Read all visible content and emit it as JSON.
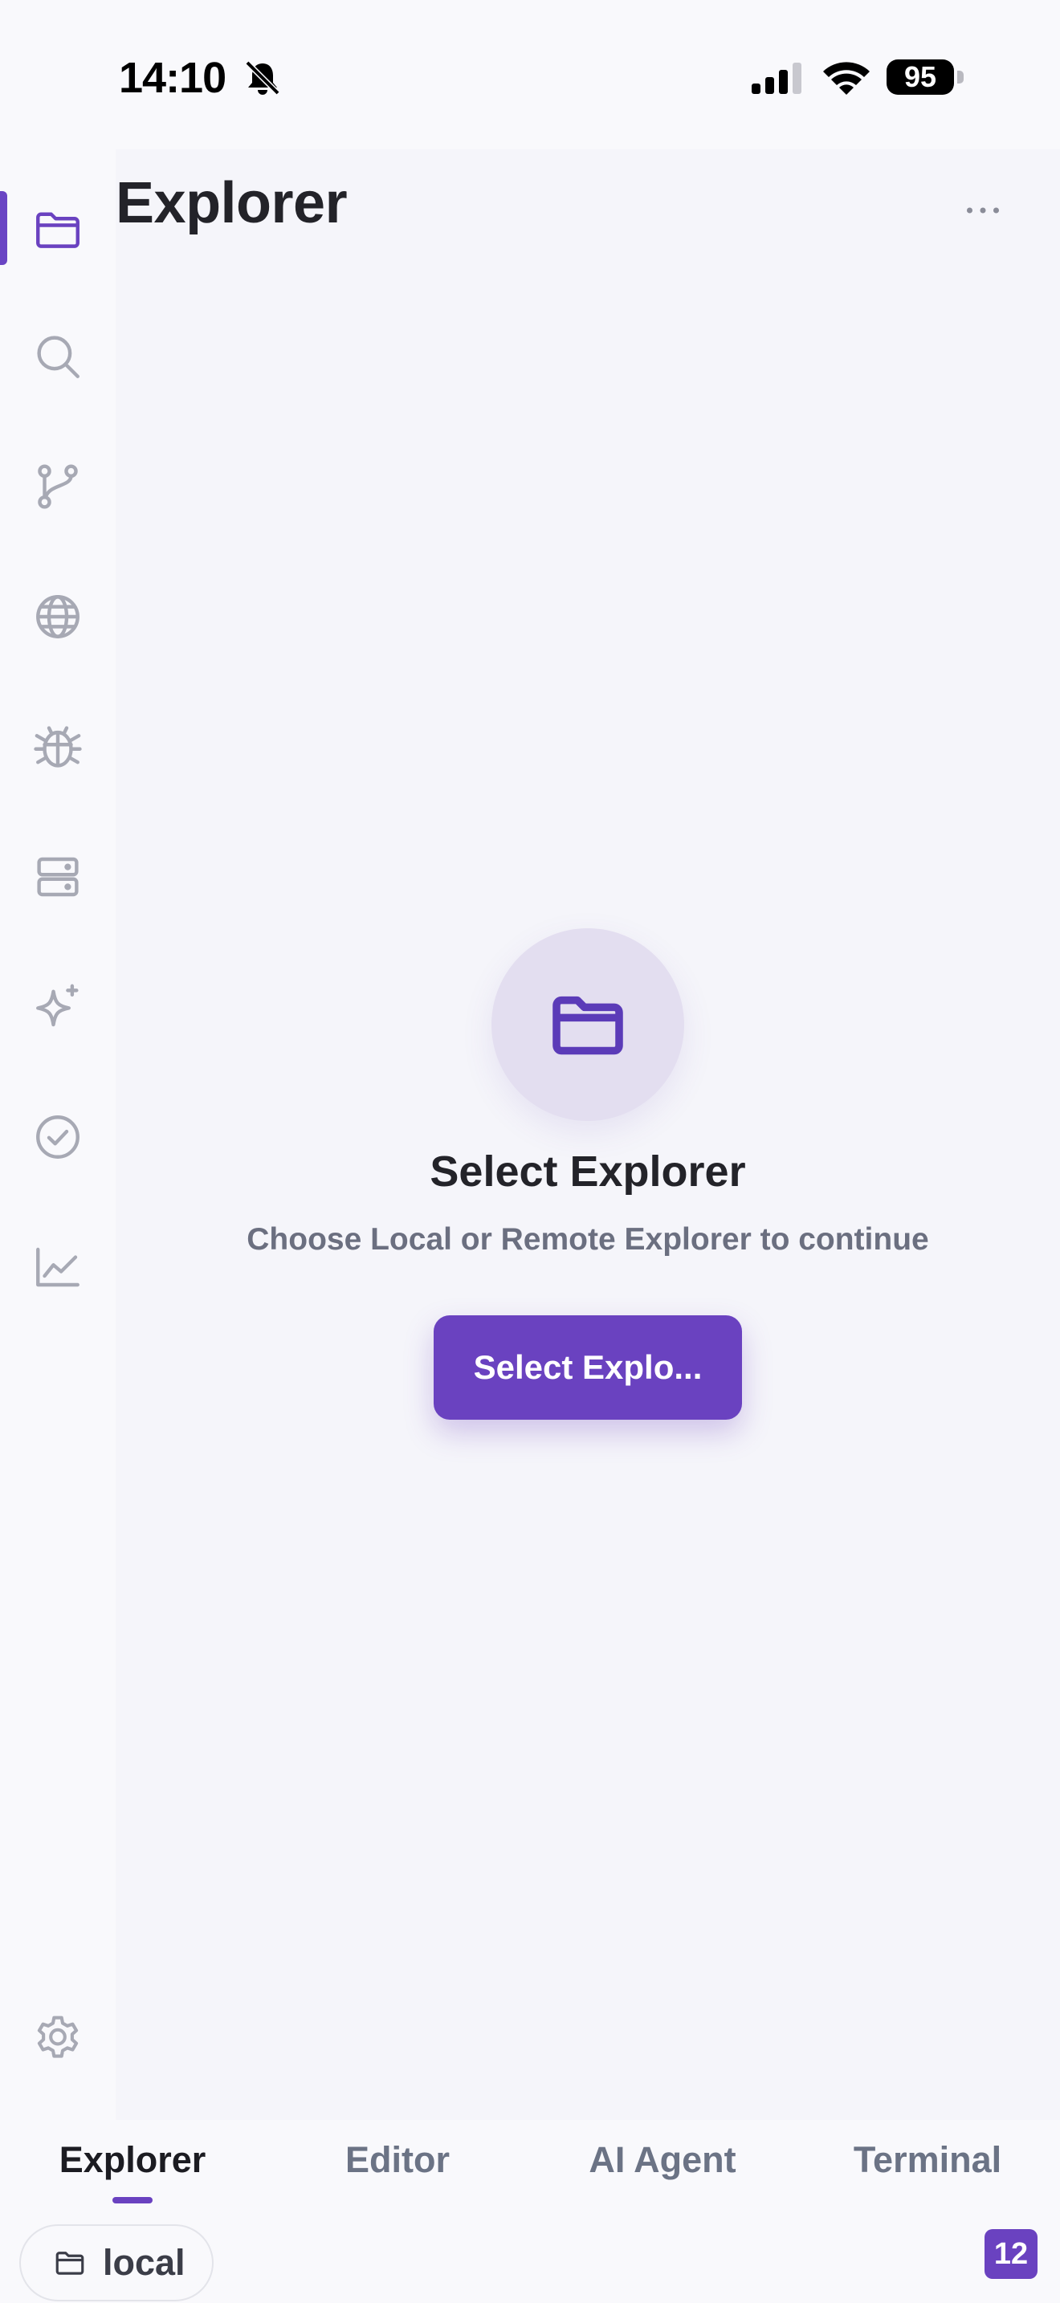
{
  "status_bar": {
    "time": "14:10",
    "battery_level": "95",
    "icons": [
      "bell-slash-icon",
      "cellular-signal-icon",
      "wifi-icon",
      "battery-icon"
    ]
  },
  "sidebar": {
    "active_index": 0,
    "items": [
      {
        "name": "explorer",
        "icon": "folder-icon"
      },
      {
        "name": "search",
        "icon": "search-icon"
      },
      {
        "name": "source-control",
        "icon": "git-branch-icon"
      },
      {
        "name": "remote",
        "icon": "globe-icon"
      },
      {
        "name": "debug",
        "icon": "bug-icon"
      },
      {
        "name": "servers",
        "icon": "server-icon"
      },
      {
        "name": "ai",
        "icon": "sparkle-icon"
      },
      {
        "name": "tasks",
        "icon": "check-circle-icon"
      },
      {
        "name": "analytics",
        "icon": "chart-icon"
      }
    ],
    "settings_icon": "gear-icon"
  },
  "main": {
    "title": "Explorer",
    "more_icon": "more-horizontal-icon",
    "empty_state": {
      "icon": "folder-icon",
      "title": "Select Explorer",
      "subtitle": "Choose Local or Remote Explorer to continue",
      "button_label": "Select Explo..."
    }
  },
  "bottom_tabs": {
    "active_index": 0,
    "items": [
      {
        "label": "Explorer"
      },
      {
        "label": "Editor"
      },
      {
        "label": "AI Agent"
      },
      {
        "label": "Terminal"
      }
    ]
  },
  "footer": {
    "env_label": "local",
    "env_icon": "folder-icon",
    "badge_count": "12"
  },
  "colors": {
    "accent": "#6a42c0",
    "background": "#f9f9fc",
    "panel": "#f5f5fa",
    "icon_gray": "#a7a9b4",
    "text_muted": "#6b7385"
  }
}
